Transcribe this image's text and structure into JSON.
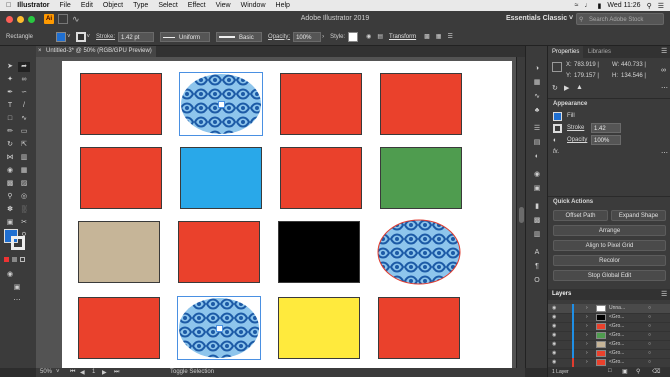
{
  "menubar": {
    "app": "Illustrator",
    "items": [
      "File",
      "Edit",
      "Object",
      "Type",
      "Select",
      "Effect",
      "View",
      "Window",
      "Help"
    ],
    "clock": "Wed 11:26"
  },
  "titlebar": {
    "title": "Adobe Illustrator 2019",
    "workspace": "Essentials Classic",
    "stock_search": "Search Adobe Stock"
  },
  "controlbar": {
    "object": "Rectangle",
    "stroke_label": "Stroke:",
    "stroke_value": "1.42 pt",
    "profile": "Uniform",
    "brush": "Basic",
    "opacity_label": "Opacity:",
    "opacity_value": "100%",
    "style_label": "Style:",
    "transform": "Transform"
  },
  "document": {
    "tab": "Untitled-3* @ 50% (RGB/GPU Preview)"
  },
  "statusbar": {
    "zoom": "50%",
    "page": "1",
    "mode": "Toggle Selection"
  },
  "properties": {
    "tab_properties": "Properties",
    "tab_libraries": "Libraries",
    "x_label": "X:",
    "x_value": "783.919 |",
    "y_label": "Y:",
    "y_value": "179.157 |",
    "w_label": "W:",
    "w_value": "440.733 |",
    "h_label": "H:",
    "h_value": "134.546 |",
    "appearance": "Appearance",
    "fill": "Fill",
    "stroke": "Stroke",
    "stroke_value": "1.42",
    "opacity": "Opacity",
    "opacity_value": "100%",
    "fx": "fx."
  },
  "quick_actions": {
    "title": "Quick Actions",
    "offset_path": "Offset Path",
    "expand_shape": "Expand Shape",
    "arrange": "Arrange",
    "align_pixel": "Align to Pixel Grid",
    "recolor": "Recolor",
    "stop_edit": "Stop Global Edit"
  },
  "layers": {
    "title": "Layers",
    "rows": [
      "Unna...",
      "<Gro...",
      "<Gro...",
      "<Gro...",
      "<Gro...",
      "<Gro...",
      "<Gro..."
    ],
    "footer": "1 Layer"
  },
  "colors": {
    "red": "#ea412c",
    "blue": "#29a8e9",
    "green": "#4f9c4f",
    "tan": "#c6b598",
    "black": "#000000",
    "yellow": "#ffea3d",
    "pattern_dark": "#1c5aa6",
    "pattern_light": "#8ec5ec",
    "selection": "#4a90e2",
    "layer_red": "#e23c2f",
    "layer_blue": "#1f8fe6"
  }
}
